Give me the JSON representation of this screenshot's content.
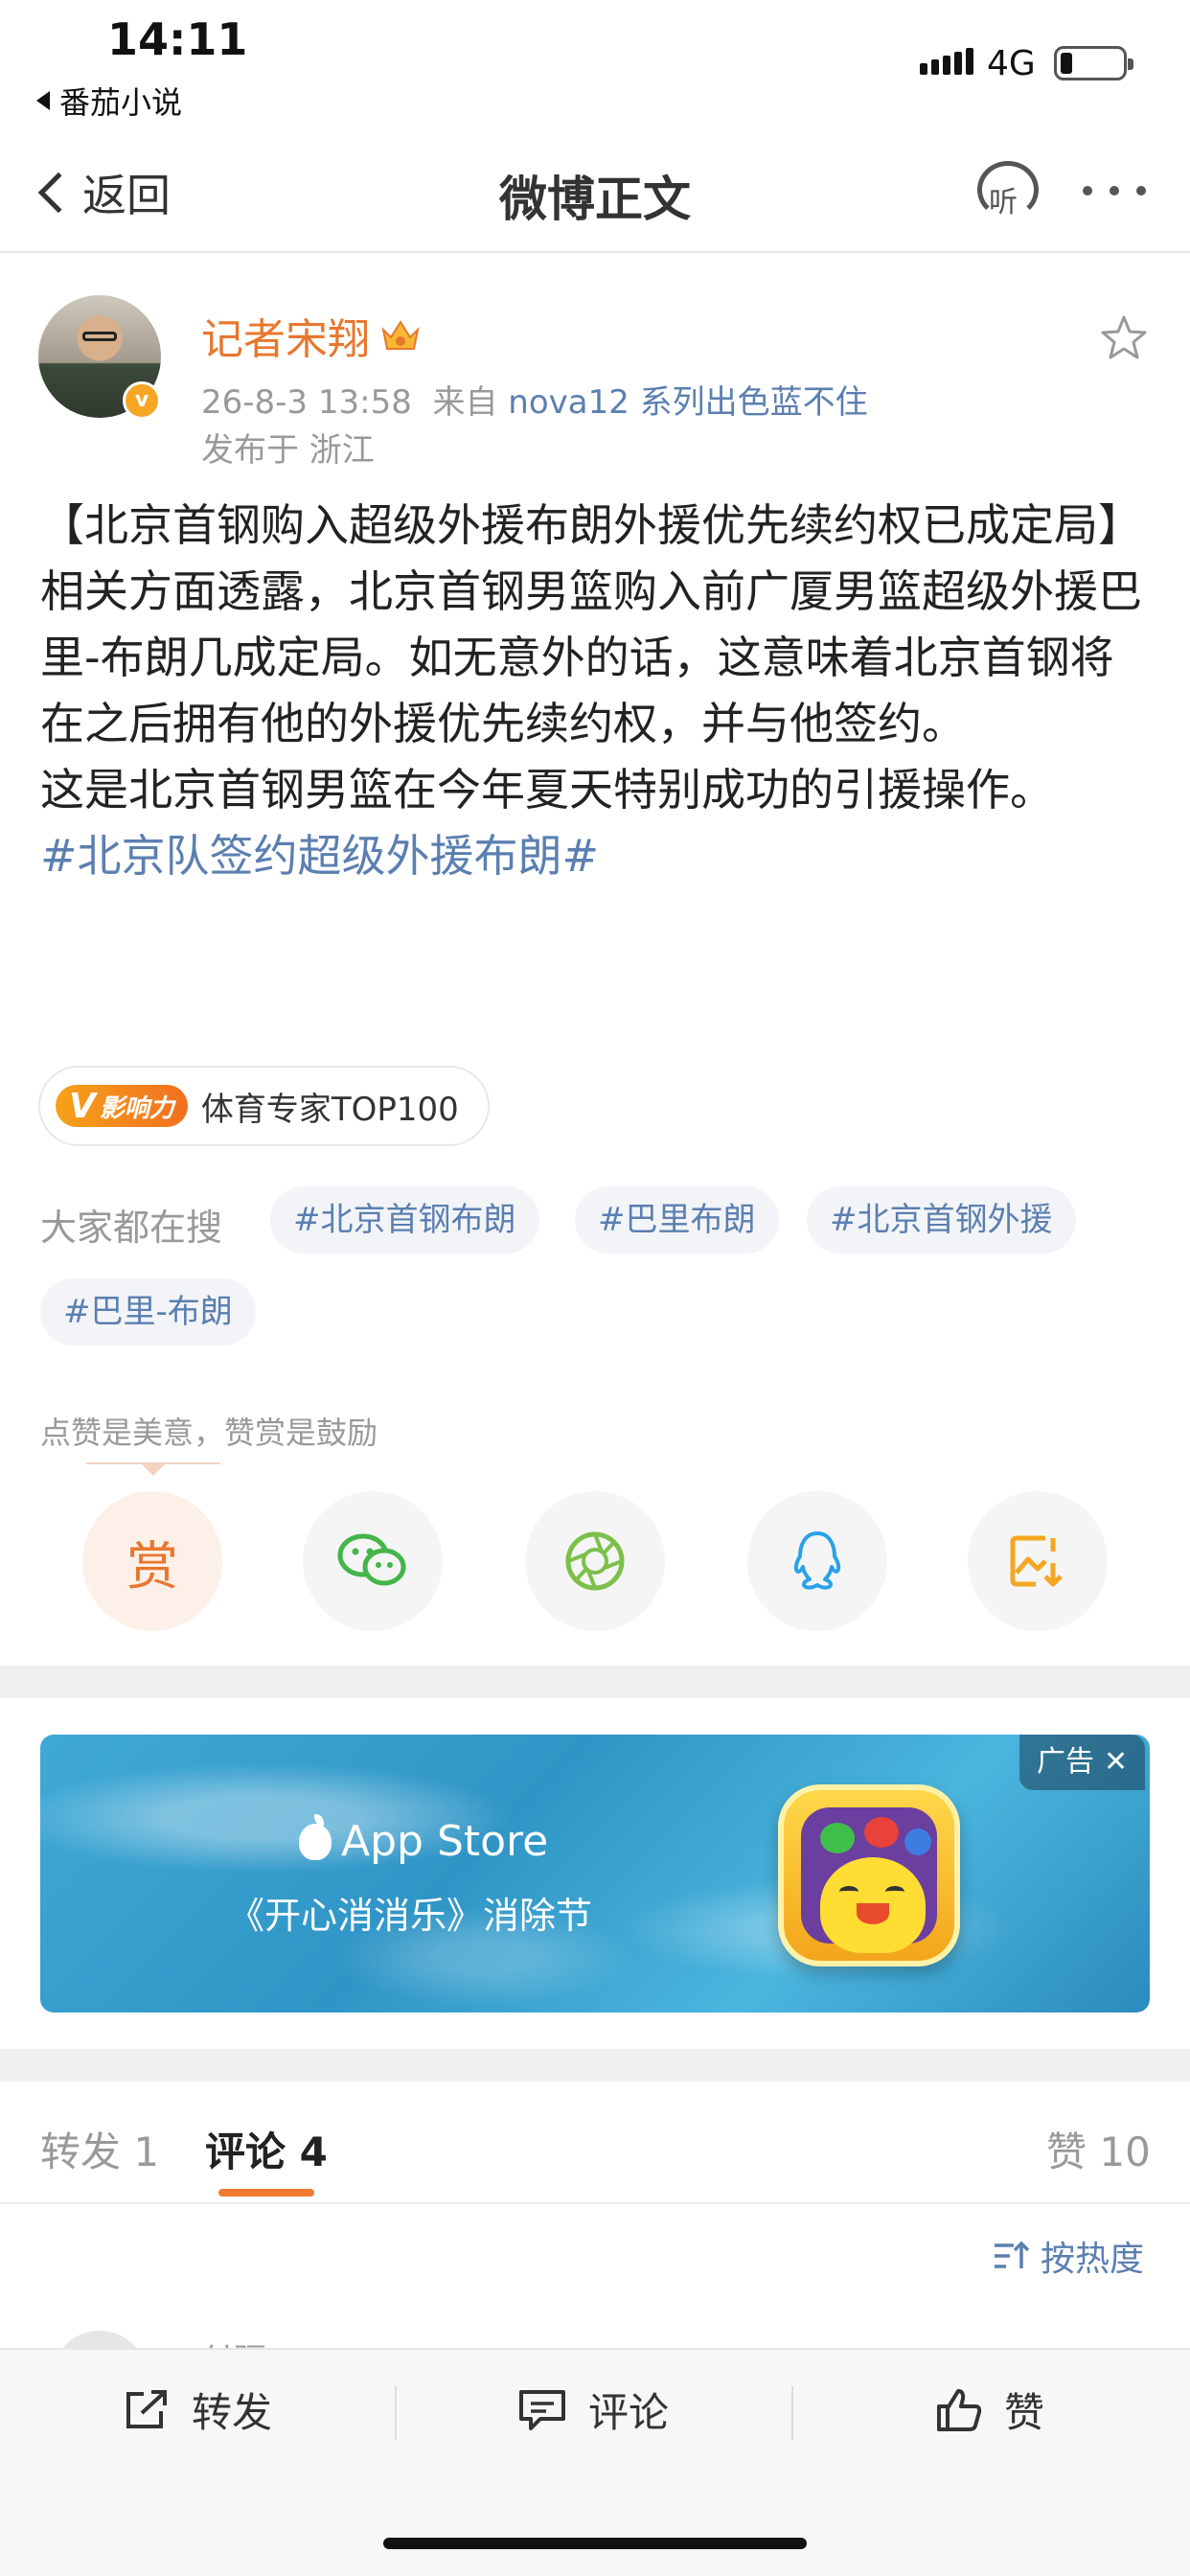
{
  "status_bar": {
    "time": "14:11",
    "back_app": "番茄小说",
    "network": "4G"
  },
  "nav": {
    "back_label": "返回",
    "title": "微博正文",
    "listen_label": "听"
  },
  "author": {
    "name": "记者宋翔",
    "verified_mark": "v",
    "date_time": "26-8-3 13:58",
    "source_prefix": "来自",
    "source_device": "nova12 系列出色蓝不住",
    "location": "发布于 浙江"
  },
  "post": {
    "title": "【北京首钢购入超级外援布朗外援优先续约权已成定局】",
    "paragraph1": "相关方面透露，北京首钢男篮购入前广厦男篮超级外援巴里-布朗几成定局。如无意外的话，这意味着北京首钢将在之后拥有他的外援优先续约权，并与他签约。",
    "paragraph2": "这是北京首钢男篮在今年夏天特别成功的引援操作。",
    "hashtag": "#北京队签约超级外援布朗#"
  },
  "influence": {
    "badge_v": "V",
    "badge_text": "影响力",
    "label": "体育专家TOP100"
  },
  "search": {
    "label": "大家都在搜",
    "chips": [
      "#北京首钢布朗",
      "#巴里布朗",
      "#北京首钢外援",
      "#巴里-布朗"
    ]
  },
  "encourage_text": "点赞是美意，赞赏是鼓励",
  "share": {
    "reward_label": "赏"
  },
  "ad": {
    "store_label": "App Store",
    "subtitle": "《开心消消乐》消除节",
    "tag": "广告",
    "close": "✕"
  },
  "tabs": {
    "repost": "转发 1",
    "comment": "评论 4",
    "like": "赞 10"
  },
  "sort_label": "按热度",
  "peek_name": "付疆",
  "bottom_bar": {
    "repost": "转发",
    "comment": "评论",
    "like": "赞"
  },
  "colors": {
    "accent_orange": "#e8772e",
    "link_blue": "#5b7fb0",
    "tab_underline": "#f07a2e"
  }
}
